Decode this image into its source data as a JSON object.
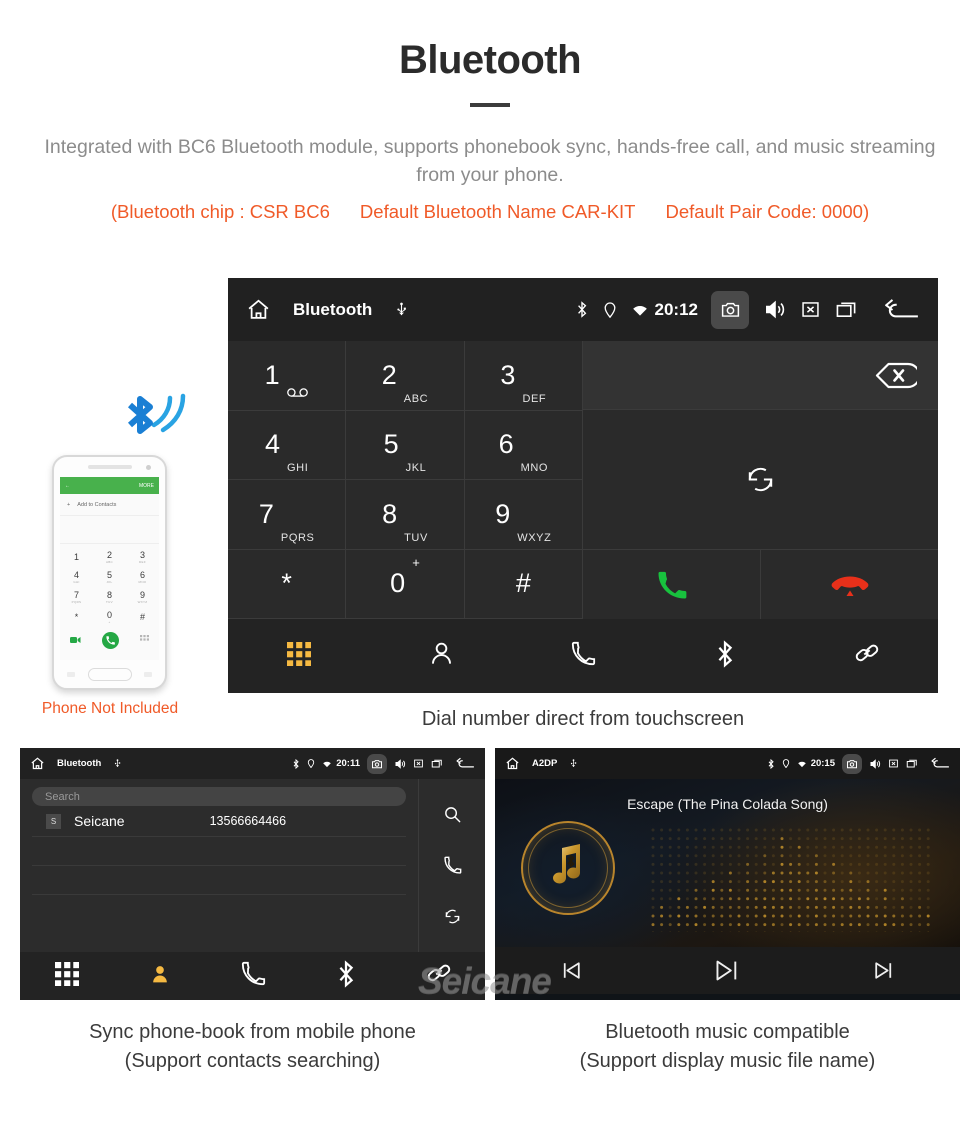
{
  "header": {
    "title": "Bluetooth",
    "intro": "Integrated with BC6 Bluetooth module, supports phonebook sync, hands-free call, and music streaming from your phone.",
    "specs": [
      "(Bluetooth chip : CSR BC6",
      "Default Bluetooth Name CAR-KIT",
      "Default Pair Code: 0000)"
    ],
    "accent_color": "#f05a28",
    "text_color": "#8c8c8c"
  },
  "dialer": {
    "statusbar": {
      "home_icon": "home-icon",
      "title": "Bluetooth",
      "usb_icon": "usb-icon",
      "bluetooth_icon": "bluetooth-icon",
      "location_icon": "location-icon",
      "wifi_icon": "wifi-icon",
      "clock": "20:12",
      "camera_icon": "camera-icon",
      "volume_icon": "volume-icon",
      "close_icon": "close-box-icon",
      "recents_icon": "recents-icon",
      "back_icon": "back-icon"
    },
    "keys": [
      {
        "num": "1",
        "sub": "",
        "voicemail": true
      },
      {
        "num": "2",
        "sub": "ABC"
      },
      {
        "num": "3",
        "sub": "DEF"
      },
      {
        "num": "4",
        "sub": "GHI"
      },
      {
        "num": "5",
        "sub": "JKL"
      },
      {
        "num": "6",
        "sub": "MNO"
      },
      {
        "num": "7",
        "sub": "PQRS"
      },
      {
        "num": "8",
        "sub": "TUV"
      },
      {
        "num": "9",
        "sub": "WXYZ"
      },
      {
        "num": "*",
        "sub": ""
      },
      {
        "num": "0",
        "sub": "",
        "plus": "+"
      },
      {
        "num": "#",
        "sub": ""
      }
    ],
    "number_value": "",
    "backspace_icon": "backspace-icon",
    "redial_icon": "redial-icon",
    "call_icon": "call-icon",
    "hangup_icon": "hangup-icon",
    "call_color": "#18c13e",
    "hangup_color": "#e8301a",
    "nav": [
      {
        "name": "keypad",
        "icon": "keypad-icon",
        "active": true
      },
      {
        "name": "contacts",
        "icon": "contact-icon",
        "active": false
      },
      {
        "name": "call-log",
        "icon": "phone-icon",
        "active": false
      },
      {
        "name": "bluetooth",
        "icon": "bluetooth-icon",
        "active": false
      },
      {
        "name": "link",
        "icon": "link-icon",
        "active": false
      }
    ],
    "active_color": "#f5b942",
    "caption": "Dial number direct from touchscreen"
  },
  "phone_mock": {
    "topbar_back": "←",
    "topbar_more": "MORE",
    "add_contact": "Add to Contacts",
    "keys": [
      {
        "num": "1",
        "sub": ""
      },
      {
        "num": "2",
        "sub": "ABC"
      },
      {
        "num": "3",
        "sub": "DEF"
      },
      {
        "num": "4",
        "sub": "GHI"
      },
      {
        "num": "5",
        "sub": "JKL"
      },
      {
        "num": "6",
        "sub": "MNO"
      },
      {
        "num": "7",
        "sub": "PQRS"
      },
      {
        "num": "8",
        "sub": "TUV"
      },
      {
        "num": "9",
        "sub": "WXYZ"
      },
      {
        "num": "*",
        "sub": ""
      },
      {
        "num": "0",
        "sub": "+"
      },
      {
        "num": "#",
        "sub": ""
      }
    ],
    "note": "Phone Not Included",
    "note_color": "#f05a28",
    "bluetooth_wave_color": "#1a9fe0"
  },
  "phonebook": {
    "statusbar": {
      "title": "Bluetooth",
      "clock": "20:11"
    },
    "search_placeholder": "Search",
    "contacts": [
      {
        "initial": "S",
        "name": "Seicane",
        "number": "13566664466"
      }
    ],
    "side_icons": [
      {
        "name": "search",
        "icon": "search-icon"
      },
      {
        "name": "call",
        "icon": "phone-icon"
      },
      {
        "name": "sync",
        "icon": "sync-icon"
      }
    ],
    "nav": [
      {
        "name": "keypad",
        "icon": "keypad-icon",
        "active": false
      },
      {
        "name": "contacts",
        "icon": "contact-filled-icon",
        "active": true
      },
      {
        "name": "call-log",
        "icon": "phone-icon",
        "active": false
      },
      {
        "name": "bluetooth",
        "icon": "bluetooth-icon",
        "active": false
      },
      {
        "name": "link",
        "icon": "link-icon",
        "active": false
      }
    ],
    "caption_line1": "Sync phone-book from mobile phone",
    "caption_line2": "(Support contacts searching)"
  },
  "music": {
    "statusbar": {
      "title": "A2DP",
      "clock": "20:15"
    },
    "track_title": "Escape (The Pina Colada Song)",
    "controls": [
      {
        "name": "previous",
        "icon": "skip-previous-icon"
      },
      {
        "name": "play-pause",
        "icon": "play-pause-icon"
      },
      {
        "name": "next",
        "icon": "skip-next-icon"
      }
    ],
    "accent_color": "#c9962c",
    "caption_line1": "Bluetooth music compatible",
    "caption_line2": "(Support display music file name)"
  },
  "watermark": "Seicane"
}
